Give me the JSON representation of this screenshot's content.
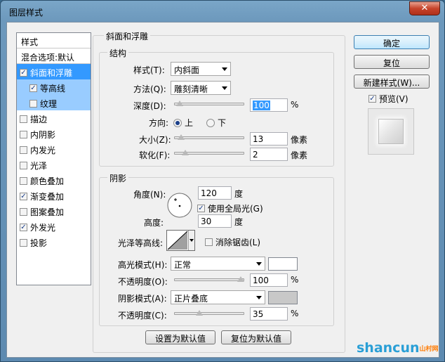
{
  "window": {
    "title": "图层样式",
    "close": "✕"
  },
  "stylelist": {
    "header": "样式",
    "blend": "混合选项:默认",
    "items": [
      {
        "label": "斜面和浮雕",
        "checked": true
      },
      {
        "label": "等高线",
        "checked": true
      },
      {
        "label": "纹理",
        "checked": false
      },
      {
        "label": "描边",
        "checked": false
      },
      {
        "label": "内阴影",
        "checked": false
      },
      {
        "label": "内发光",
        "checked": false
      },
      {
        "label": "光泽",
        "checked": false
      },
      {
        "label": "颜色叠加",
        "checked": false
      },
      {
        "label": "渐变叠加",
        "checked": true
      },
      {
        "label": "图案叠加",
        "checked": false
      },
      {
        "label": "外发光",
        "checked": true
      },
      {
        "label": "投影",
        "checked": false
      }
    ]
  },
  "bevel": {
    "title": "斜面和浮雕",
    "structure": {
      "title": "结构",
      "style_label": "样式(T):",
      "style_value": "内斜面",
      "technique_label": "方法(Q):",
      "technique_value": "雕刻清晰",
      "depth_label": "深度(D):",
      "depth_value": "100",
      "depth_unit": "%",
      "depth_pct": 0.03,
      "direction_label": "方向:",
      "dir_up": "上",
      "dir_down": "下",
      "size_label": "大小(Z):",
      "size_value": "13",
      "size_unit": "像素",
      "size_pct": 0.06,
      "soften_label": "软化(F):",
      "soften_value": "2",
      "soften_unit": "像素",
      "soften_pct": 0.12
    },
    "shading": {
      "title": "阴影",
      "angle_label": "角度(N):",
      "angle_value": "120",
      "angle_unit": "度",
      "global_light_label": "使用全局光(G)",
      "altitude_label": "高度:",
      "altitude_value": "30",
      "altitude_unit": "度",
      "gloss_label": "光泽等高线:",
      "antialias_label": "消除锯齿(L)",
      "highlight_label": "高光模式(H):",
      "highlight_value": "正常",
      "highlight_color": "#ffffff",
      "hl_opacity_label": "不透明度(O):",
      "hl_opacity_value": "100",
      "hl_opacity_unit": "%",
      "hl_opacity_pct": 1.0,
      "shadow_label": "阴影模式(A):",
      "shadow_value": "正片叠底",
      "shadow_color": "#c8c8c8",
      "sh_opacity_label": "不透明度(C):",
      "sh_opacity_value": "35",
      "sh_opacity_unit": "%",
      "sh_opacity_pct": 0.35
    },
    "make_default": "设置为默认值",
    "reset_default": "复位为默认值"
  },
  "buttons": {
    "ok": "确定",
    "reset": "复位",
    "new_style": "新建样式(W)...",
    "preview": "预览(V)"
  },
  "watermark": {
    "text": "shancun",
    "sub": "山村网"
  }
}
